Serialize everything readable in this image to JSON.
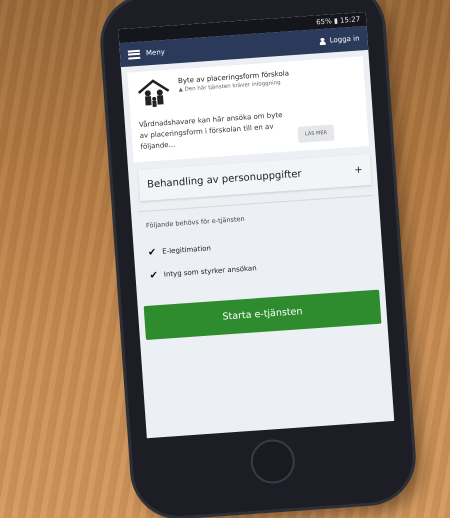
{
  "status": {
    "text": "65% ▮ 15:27"
  },
  "appbar": {
    "menu_label": "Meny",
    "login_label": "Logga in"
  },
  "service": {
    "title": "Byte av placeringsform förskola",
    "login_note": "Den här tjänsten kräver inloggning",
    "description": "Vårdnadshavare kan här ansöka om byte av placeringsform i förskolan till en av följande...",
    "read_more": "LÄS MER"
  },
  "accordion": {
    "label": "Behandling av personuppgifter",
    "icon": "+"
  },
  "requirements": {
    "heading": "Följande behövs för e-tjänsten",
    "items": [
      {
        "label": "E-legitimation"
      },
      {
        "label": "Intyg som styrker ansökan"
      }
    ]
  },
  "start_button": {
    "label": "Starta e-tjänsten"
  },
  "colors": {
    "appbar": "#2b3a5a",
    "start": "#2e8b2e"
  }
}
